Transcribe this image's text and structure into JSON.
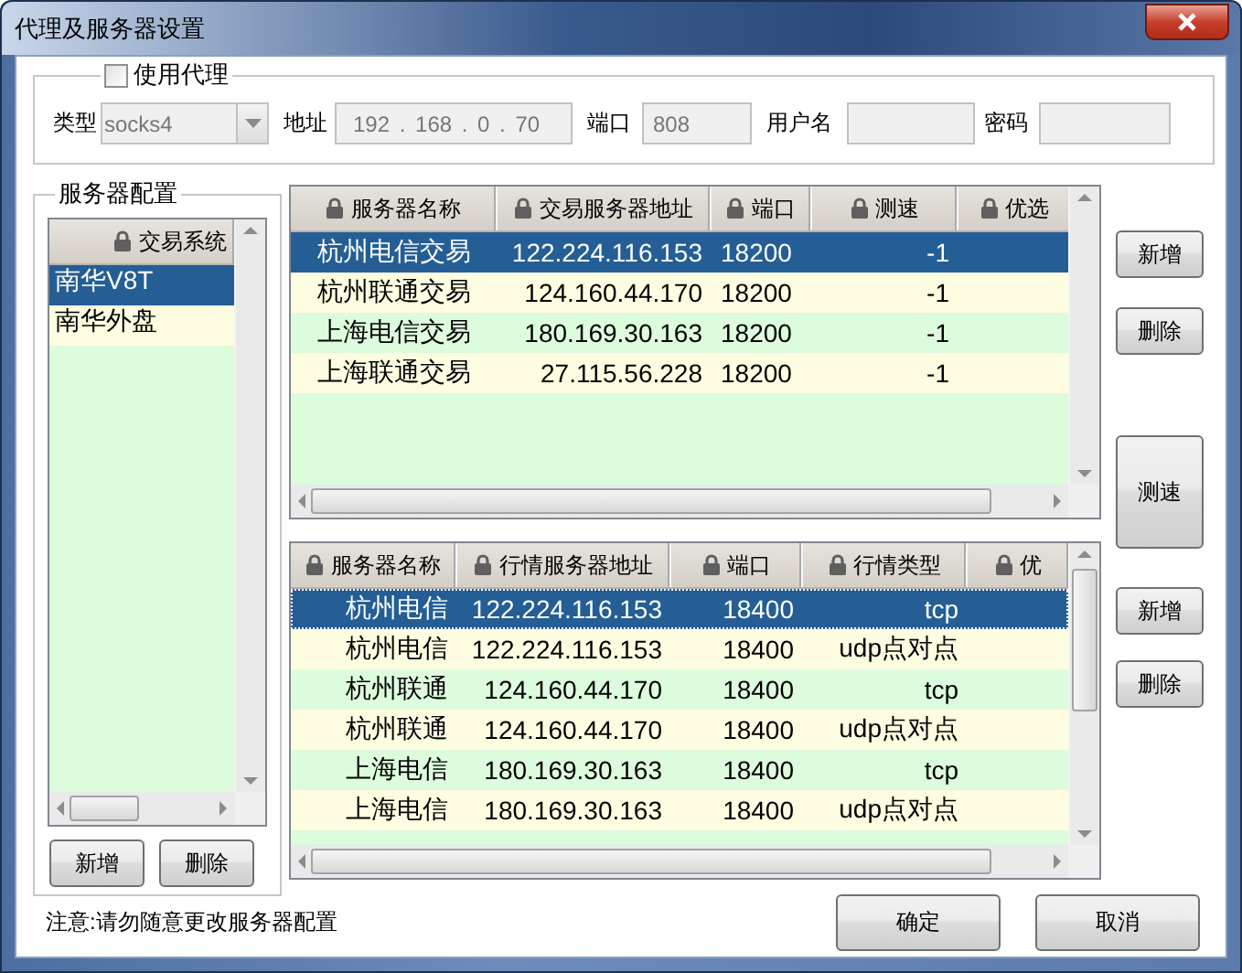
{
  "window": {
    "title": "代理及服务器设置"
  },
  "proxy": {
    "use_proxy": {
      "label": "使用代理",
      "checked": false
    },
    "fields": [
      {
        "kind": "select",
        "label": "类型",
        "value": "socks4",
        "disabled": true
      },
      {
        "kind": "ip",
        "label": "地址",
        "value": "192 . 168 . 0 . 70",
        "disabled": true
      },
      {
        "kind": "port",
        "label": "端口",
        "value": "808",
        "disabled": true
      },
      {
        "kind": "user",
        "label": "用户名",
        "disabled": true
      },
      {
        "kind": "password",
        "label": "密码",
        "disabled": true
      }
    ]
  },
  "server_config": {
    "title": "服务器配置",
    "systems": {
      "columns": [
        "交易系统"
      ],
      "rows": [
        {
          "cells": [
            "南华V8T"
          ],
          "selected": true
        },
        {
          "cells": [
            "南华外盘"
          ],
          "selected": false
        }
      ]
    },
    "buttons": [
      "新增",
      "删除"
    ]
  },
  "trade_servers": {
    "columns": [
      "服务器名称",
      "交易服务器地址",
      "端口",
      "测速",
      "优选"
    ],
    "rows": [
      {
        "cells": [
          "杭州电信交易",
          "122.224.116.153",
          "18200",
          "-1"
        ],
        "selected": true
      },
      {
        "cells": [
          "杭州联通交易",
          "124.160.44.170",
          "18200",
          "-1"
        ],
        "selected": false
      },
      {
        "cells": [
          "上海电信交易",
          "180.169.30.163",
          "18200",
          "-1"
        ],
        "selected": false
      },
      {
        "cells": [
          "上海联通交易",
          "27.115.56.228",
          "18200",
          "-1"
        ],
        "selected": false
      }
    ],
    "buttons": [
      "新增",
      "删除",
      "测速"
    ]
  },
  "market_servers": {
    "columns": [
      "服务器名称",
      "行情服务器地址",
      "端口",
      "行情类型",
      "优"
    ],
    "rows": [
      {
        "cells": [
          "杭州电信",
          "122.224.116.153",
          "18400",
          "tcp"
        ],
        "selected": true
      },
      {
        "cells": [
          "杭州电信",
          "122.224.116.153",
          "18400",
          "udp点对点"
        ],
        "selected": false
      },
      {
        "cells": [
          "杭州联通",
          "124.160.44.170",
          "18400",
          "tcp"
        ],
        "selected": false
      },
      {
        "cells": [
          "杭州联通",
          "124.160.44.170",
          "18400",
          "udp点对点"
        ],
        "selected": false
      },
      {
        "cells": [
          "上海电信",
          "180.169.30.163",
          "18400",
          "tcp"
        ],
        "selected": false
      },
      {
        "cells": [
          "上海电信",
          "180.169.30.163",
          "18400",
          "udp点对点"
        ],
        "selected": false
      }
    ],
    "buttons": [
      "新增",
      "删除"
    ]
  },
  "note": "注意:请勿随意更改服务器配置",
  "buttons": [
    "确定",
    "取消"
  ]
}
